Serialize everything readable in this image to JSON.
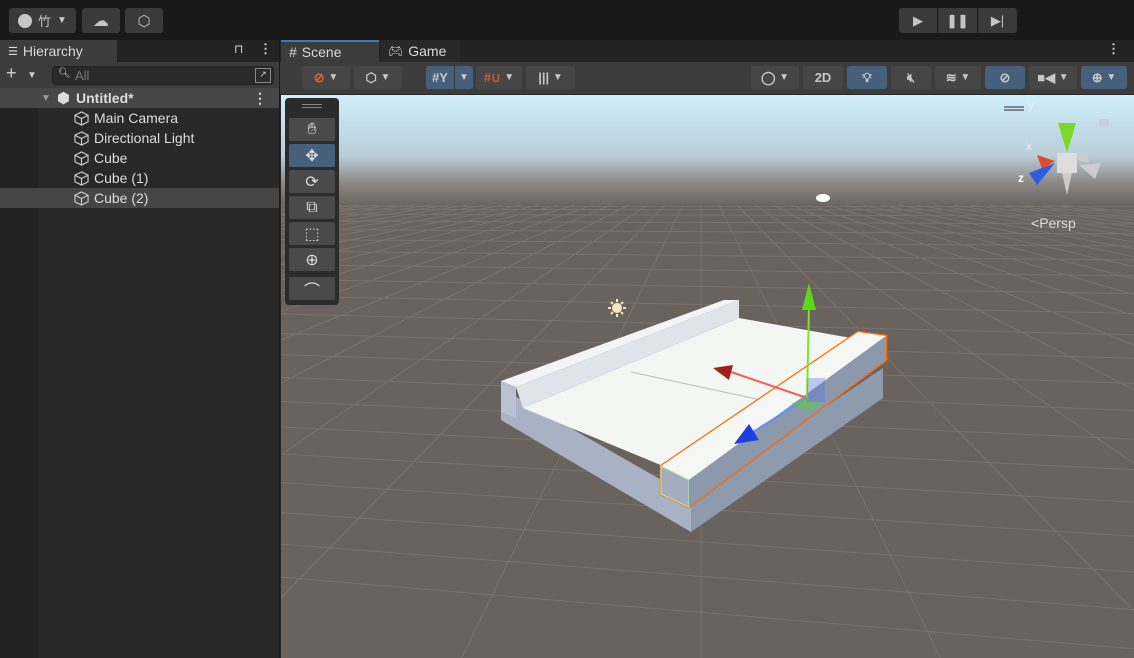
{
  "toolbar": {
    "account_label": "竹",
    "icons": [
      "account-icon",
      "cloud-icon",
      "collab-icon",
      "play-icon",
      "pause-icon",
      "step-icon"
    ]
  },
  "hierarchy": {
    "tab_label": "Hierarchy",
    "search_placeholder": "All",
    "scene_name": "Untitled*",
    "items": [
      {
        "label": "Main Camera",
        "selected": false
      },
      {
        "label": "Directional Light",
        "selected": false
      },
      {
        "label": "Cube",
        "selected": false
      },
      {
        "label": "Cube (1)",
        "selected": false
      },
      {
        "label": "Cube (2)",
        "selected": true
      }
    ]
  },
  "scene": {
    "tabs": [
      {
        "label": "Scene",
        "active": true
      },
      {
        "label": "Game",
        "active": false
      }
    ],
    "toolbar": {
      "two_d_label": "2D"
    },
    "tools": [
      "hand",
      "move",
      "rotate",
      "scale",
      "rect",
      "transform",
      "custom"
    ],
    "active_tool": "move",
    "gizmo": {
      "x_label": "x",
      "y_label": "y",
      "z_label": "z",
      "projection": "Persp"
    },
    "colors": {
      "selection": "#ff6a00",
      "x_axis": "#d83a2a",
      "y_axis": "#7be52a",
      "z_axis": "#2a56e0",
      "active_button": "#46607c"
    }
  }
}
